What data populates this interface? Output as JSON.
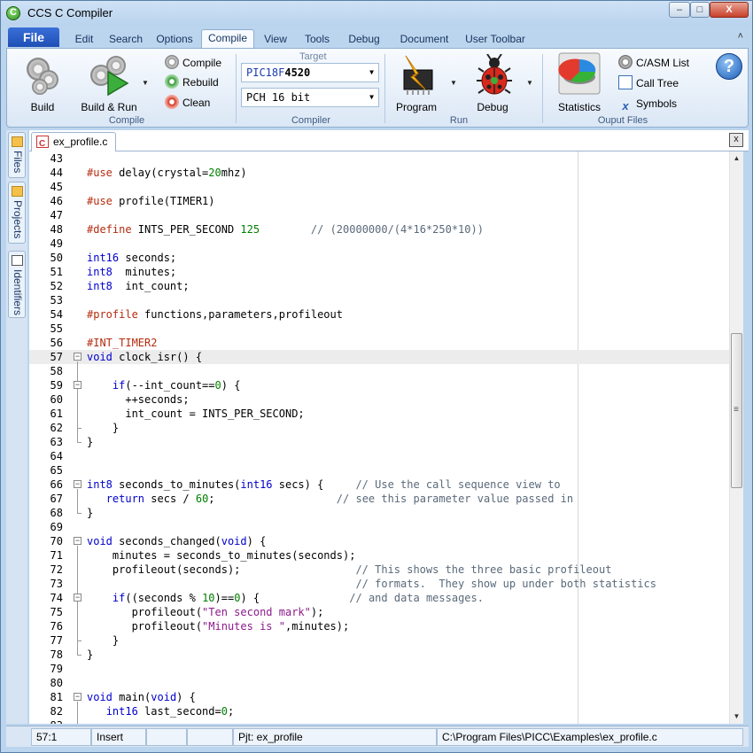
{
  "window": {
    "title": "CCS C Compiler",
    "minimize": "–",
    "maximize": "□",
    "close": "X"
  },
  "ribbon": {
    "file_tab": "File",
    "tabs": [
      "Edit",
      "Search",
      "Options",
      "Compile",
      "View",
      "Tools",
      "Debug",
      "Document",
      "User Toolbar"
    ],
    "active_tab": "Compile",
    "collapse_glyph": "˄",
    "compile_group": {
      "label": "Compile",
      "build": "Build",
      "build_run": "Build & Run",
      "compile": "Compile",
      "rebuild": "Rebuild",
      "clean": "Clean"
    },
    "compiler_group": {
      "label": "Compiler",
      "target_label": "Target",
      "target_value_prefix": "PIC18F",
      "target_value_model": "4520",
      "compiler_value": "PCH 16 bit"
    },
    "run_group": {
      "label": "Run",
      "program": "Program",
      "debug": "Debug"
    },
    "output_group": {
      "label": "Ouput Files",
      "statistics": "Statistics",
      "casm_list": "C/ASM List",
      "call_tree": "Call Tree",
      "symbols": "Symbols"
    },
    "help_glyph": "?"
  },
  "side_tabs": [
    "Files",
    "Projects",
    "Identifiers"
  ],
  "editor": {
    "tab_label": "ex_profile.c",
    "close_glyph": "x",
    "current_line": 57,
    "lines": [
      {
        "n": "43",
        "html": ""
      },
      {
        "n": "44",
        "html": "<span class=\"pp\">#use</span> delay(crystal=<span class=\"num\">20</span>mhz)"
      },
      {
        "n": "45",
        "html": ""
      },
      {
        "n": "46",
        "html": "<span class=\"pp\">#use</span> profile(TIMER1)"
      },
      {
        "n": "47",
        "html": ""
      },
      {
        "n": "48",
        "html": "<span class=\"pp\">#define</span> INTS_PER_SECOND <span class=\"num\">125</span>        <span class=\"cm\">// (20000000/(4*16*250*10))</span>"
      },
      {
        "n": "49",
        "html": ""
      },
      {
        "n": "50",
        "html": "<span class=\"kw\">int16</span> seconds;"
      },
      {
        "n": "51",
        "html": "<span class=\"kw\">int8</span>  minutes;"
      },
      {
        "n": "52",
        "html": "<span class=\"kw\">int8</span>  int_count;"
      },
      {
        "n": "53",
        "html": ""
      },
      {
        "n": "54",
        "html": "<span class=\"pp\">#profile</span> functions,parameters,profileout"
      },
      {
        "n": "55",
        "html": ""
      },
      {
        "n": "56",
        "html": "<span class=\"pp\">#INT_TIMER2</span>"
      },
      {
        "n": "57",
        "html": "<span class=\"kw\">void</span> clock_isr() {"
      },
      {
        "n": "58",
        "html": ""
      },
      {
        "n": "59",
        "html": "    <span class=\"kw\">if</span>(--int_count==<span class=\"num\">0</span>) {"
      },
      {
        "n": "60",
        "html": "      ++seconds;"
      },
      {
        "n": "61",
        "html": "      int_count = INTS_PER_SECOND;"
      },
      {
        "n": "62",
        "html": "    }"
      },
      {
        "n": "63",
        "html": "}"
      },
      {
        "n": "64",
        "html": ""
      },
      {
        "n": "65",
        "html": ""
      },
      {
        "n": "66",
        "html": "<span class=\"kw\">int8</span> seconds_to_minutes(<span class=\"kw\">int16</span> secs) {     <span class=\"cm\">// Use the call sequence view to</span>"
      },
      {
        "n": "67",
        "html": "   <span class=\"kw\">return</span> secs / <span class=\"num\">60</span>;                   <span class=\"cm\">// see this parameter value passed in</span>"
      },
      {
        "n": "68",
        "html": "}"
      },
      {
        "n": "69",
        "html": ""
      },
      {
        "n": "70",
        "html": "<span class=\"kw\">void</span> seconds_changed(<span class=\"kw\">void</span>) {"
      },
      {
        "n": "71",
        "html": "    minutes = seconds_to_minutes(seconds);"
      },
      {
        "n": "72",
        "html": "    profileout(seconds);                  <span class=\"cm\">// This shows the three basic profileout</span>"
      },
      {
        "n": "73",
        "html": "                                          <span class=\"cm\">// formats.  They show up under both statistics</span>"
      },
      {
        "n": "74",
        "html": "    <span class=\"kw\">if</span>((seconds % <span class=\"num\">10</span>)==<span class=\"num\">0</span>) {              <span class=\"cm\">// and data messages.</span>"
      },
      {
        "n": "75",
        "html": "       profileout(<span class=\"str\">\"Ten second mark\"</span>);"
      },
      {
        "n": "76",
        "html": "       profileout(<span class=\"str\">\"Minutes is \"</span>,minutes);"
      },
      {
        "n": "77",
        "html": "    }"
      },
      {
        "n": "78",
        "html": "}"
      },
      {
        "n": "79",
        "html": ""
      },
      {
        "n": "80",
        "html": ""
      },
      {
        "n": "81",
        "html": "<span class=\"kw\">void</span> main(<span class=\"kw\">void</span>) {"
      },
      {
        "n": "82",
        "html": "   <span class=\"kw\">int16</span> last_second=<span class=\"num\">0</span>;"
      },
      {
        "n": "83",
        "html": ""
      }
    ]
  },
  "statusbar": {
    "position": "57:1",
    "mode": "Insert",
    "empty1": "",
    "empty2": "",
    "project": "Pjt: ex_profile",
    "path": "C:\\Program Files\\PICC\\Examples\\ex_profile.c"
  },
  "colors": {
    "keyword": "#0000cc",
    "preprocessor": "#b52b0e",
    "number": "#008000",
    "comment": "#5a6a7a",
    "string": "#8b1a8b",
    "file_tab": "#1e4fb5"
  }
}
